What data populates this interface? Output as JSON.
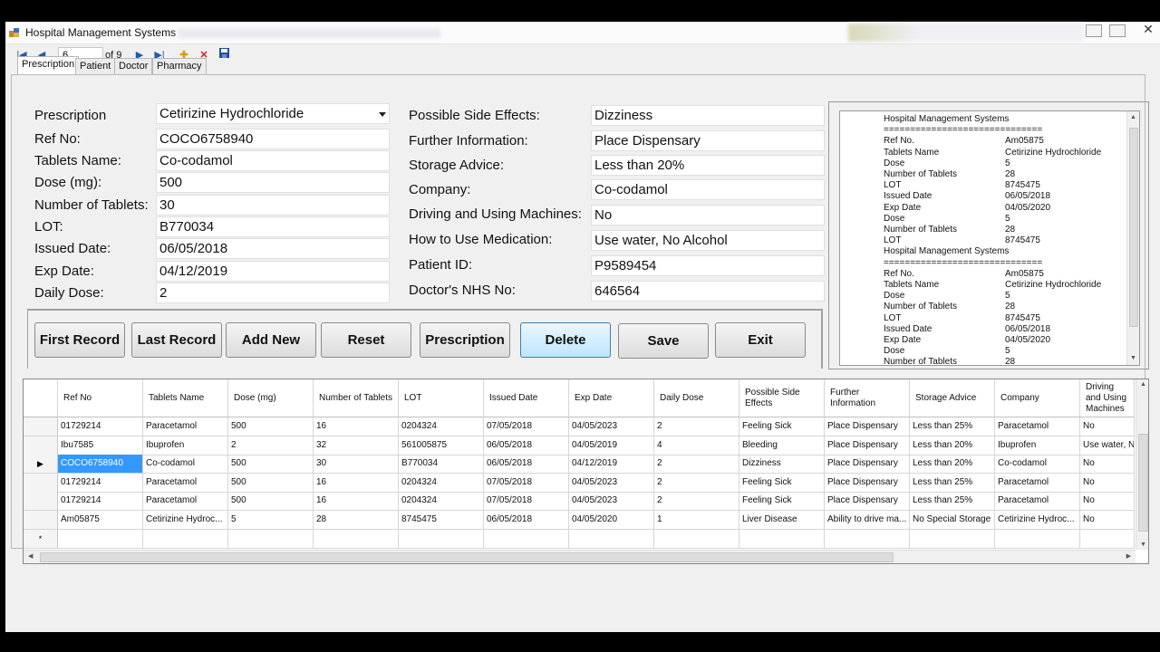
{
  "window": {
    "title": "Hospital Management Systems"
  },
  "navigator": {
    "position": "6",
    "count_label": "of 9"
  },
  "tabs": [
    "Prescription",
    "Patient",
    "Doctor",
    "Pharmacy"
  ],
  "form_left": [
    {
      "label": "Prescription",
      "value": "Cetirizine Hydrochloride"
    },
    {
      "label": "Ref No:",
      "value": "COCO6758940"
    },
    {
      "label": "Tablets Name:",
      "value": "Co-codamol"
    },
    {
      "label": "Dose (mg):",
      "value": "500"
    },
    {
      "label": "Number of Tablets:",
      "value": "30"
    },
    {
      "label": "LOT:",
      "value": "B770034"
    },
    {
      "label": "Issued Date:",
      "value": "06/05/2018"
    },
    {
      "label": "Exp Date:",
      "value": "04/12/2019"
    },
    {
      "label": "Daily Dose:",
      "value": "2"
    }
  ],
  "form_right": [
    {
      "label": "Possible Side Effects:",
      "value": "Dizziness"
    },
    {
      "label": "Further Information:",
      "value": "Place Dispensary"
    },
    {
      "label": "Storage Advice:",
      "value": "Less than 20%"
    },
    {
      "label": "Company:",
      "value": "Co-codamol"
    },
    {
      "label": "Driving and Using Machines:",
      "value": "No"
    },
    {
      "label": "How to Use Medication:",
      "value": "Use water, No Alcohol"
    },
    {
      "label": "Patient  ID:",
      "value": "P9589454"
    },
    {
      "label": "Doctor's NHS No:",
      "value": "646564"
    }
  ],
  "buttons": [
    "First Record",
    "Last Record",
    "Add New",
    "Reset",
    "Prescription",
    "Delete",
    "Save",
    "Exit"
  ],
  "receipt": [
    [
      "Hospital Management Systems",
      ""
    ],
    [
      "==============================",
      ""
    ],
    [
      "Ref No.",
      "Am05875"
    ],
    [
      "Tablets Name",
      "Cetirizine Hydrochloride"
    ],
    [
      "Dose",
      "5"
    ],
    [
      "Number of Tablets",
      "28"
    ],
    [
      "LOT",
      "8745475"
    ],
    [
      "Issued Date",
      "06/05/2018"
    ],
    [
      "Exp Date",
      "04/05/2020"
    ],
    [
      "Dose",
      "5"
    ],
    [
      "Number of Tablets",
      "28"
    ],
    [
      "LOT",
      "8745475"
    ],
    [
      "Hospital Management Systems",
      ""
    ],
    [
      "==============================",
      ""
    ],
    [
      "Ref No.",
      "Am05875"
    ],
    [
      "Tablets Name",
      "Cetirizine Hydrochloride"
    ],
    [
      "Dose",
      "5"
    ],
    [
      "Number of Tablets",
      "28"
    ],
    [
      "LOT",
      "8745475"
    ],
    [
      "Issued Date",
      "06/05/2018"
    ],
    [
      "Exp Date",
      "04/05/2020"
    ],
    [
      "Dose",
      "5"
    ],
    [
      "Number of Tablets",
      "28"
    ]
  ],
  "grid": {
    "columns": [
      "Ref No",
      "Tablets Name",
      "Dose (mg)",
      "Number of Tablets",
      "LOT",
      "Issued Date",
      "Exp Date",
      "Daily Dose",
      "Possible Side Effects",
      "Further Information",
      "Storage Advice",
      "Company",
      "Driving and Using Machines"
    ],
    "rows": [
      [
        "01729214",
        "Paracetamol",
        "500",
        "16",
        "0204324",
        "07/05/2018",
        "04/05/2023",
        "2",
        "Feeling Sick",
        "Place Dispensary",
        "Less than 25%",
        "Paracetamol",
        "No"
      ],
      [
        "Ibu7585",
        "Ibuprofen",
        "2",
        "32",
        "561005875",
        "06/05/2018",
        "04/05/2019",
        "4",
        "Bleeding",
        "Place Dispensary",
        "Less than 20%",
        "Ibuprofen",
        "Use water, No"
      ],
      [
        "COCO6758940",
        "Co-codamol",
        "500",
        "30",
        "B770034",
        "06/05/2018",
        "04/12/2019",
        "2",
        "Dizziness",
        "Place Dispensary",
        "Less than 20%",
        "Co-codamol",
        "No"
      ],
      [
        "01729214",
        "Paracetamol",
        "500",
        "16",
        "0204324",
        "07/05/2018",
        "04/05/2023",
        "2",
        "Feeling Sick",
        "Place Dispensary",
        "Less than 25%",
        "Paracetamol",
        "No"
      ],
      [
        "01729214",
        "Paracetamol",
        "500",
        "16",
        "0204324",
        "07/05/2018",
        "04/05/2023",
        "2",
        "Feeling Sick",
        "Place Dispensary",
        "Less than 25%",
        "Paracetamol",
        "No"
      ],
      [
        "Am05875",
        "Cetirizine Hydroc...",
        "5",
        "28",
        "8745475",
        "06/05/2018",
        "04/05/2020",
        "1",
        "Liver Disease",
        "Ability to drive ma...",
        "No Special Storage",
        "Cetirizine Hydroc...",
        "No"
      ]
    ],
    "selected_row": 2
  }
}
